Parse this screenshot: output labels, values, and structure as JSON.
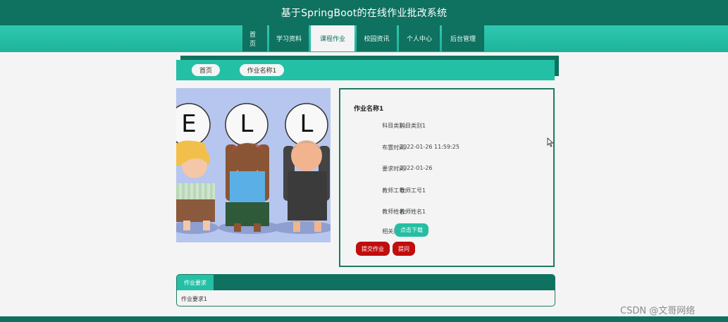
{
  "header": {
    "title": "基于SpringBoot的在线作业批改系统"
  },
  "nav": {
    "items": [
      {
        "label": "首页"
      },
      {
        "label": "学习资料"
      },
      {
        "label": "课程作业"
      },
      {
        "label": "校园资讯"
      },
      {
        "label": "个人中心"
      },
      {
        "label": "后台管理"
      }
    ],
    "active": "课程作业"
  },
  "breadcrumb": {
    "home": "首页",
    "current": "作业名称1"
  },
  "detail": {
    "title": "作业名称1",
    "fields": [
      {
        "label": "科目类别:",
        "value": "科目类别1"
      },
      {
        "label": "布置时间:",
        "value": "2022-01-26 11:59:25"
      },
      {
        "label": "要求时间:",
        "value": "2022-01-26"
      },
      {
        "label": "教师工号:",
        "value": "教师工号1"
      },
      {
        "label": "教师姓名:",
        "value": "教师姓名1"
      }
    ],
    "attachment_label": "相关附件:",
    "download_label": "点击下载",
    "submit_label": "提交作业",
    "ask_label": "提问"
  },
  "requirements": {
    "tab_label": "作业要求",
    "content": "作业要求1"
  },
  "image": {
    "letters": [
      "E",
      "L",
      "L"
    ]
  },
  "watermark": "CSDN @文哥网络",
  "colors": {
    "primary_dark": "#0f7160",
    "primary": "#24c0a6",
    "danger": "#c00d0d",
    "background": "#f4f4f4"
  }
}
